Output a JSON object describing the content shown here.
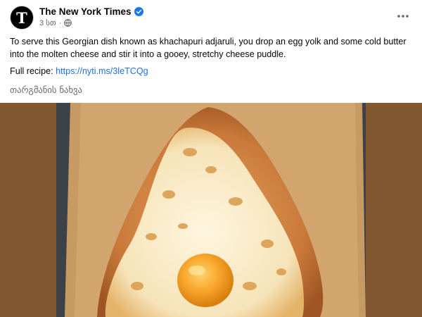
{
  "post": {
    "author": "The New York Times",
    "avatar_letter": "T",
    "time": "3 სთ",
    "separator": "·",
    "text": "To serve this Georgian dish known as khachapuri adjaruli, you drop an egg yolk and some cold butter into the molten cheese and stir it into a gooey, stretchy cheese puddle.",
    "recipe_label": "Full recipe:",
    "recipe_link": "https://nyti.ms/3leTCQg",
    "translate": "თარგმანის ნახვა",
    "more_icon": "more-horizontal-icon",
    "verified_icon": "verified-badge-icon",
    "privacy_icon": "globe-icon"
  },
  "colors": {
    "link": "#216fdb",
    "verified": "#1877f2",
    "photo_background": "#82562f",
    "secondary_text": "#65676b"
  }
}
